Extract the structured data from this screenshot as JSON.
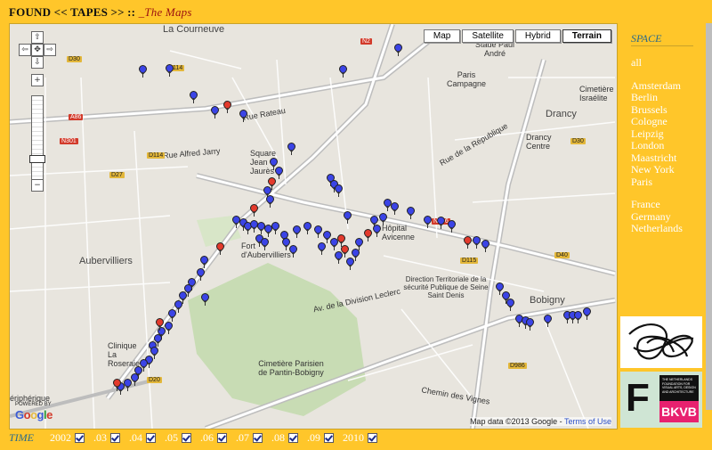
{
  "header": {
    "title": "FOUND << TAPES >> :: ",
    "subtitle": "_The Maps"
  },
  "map": {
    "types": [
      "Map",
      "Satellite",
      "Hybrid",
      "Terrain"
    ],
    "active_type": "Terrain",
    "labels": {
      "la_courneuve": "La Courneuve",
      "stade": "Stade Paul André",
      "paris_campagne": "Paris Campagne",
      "cimetiere_israelite": "Cimetière Israélite",
      "drancy": "Drancy",
      "drancy_centre": "Drancy Centre",
      "aubervilliers": "Aubervilliers",
      "fort": "Fort d'Aubervilliers",
      "cimetiere_parisien": "Cimetière Parisien de Pantin-Bobigny",
      "bobigny": "Bobigny",
      "hopital": "Hôpital Avicenne",
      "direction": "Direction Territoriale de la sécurité Publique de Seine Saint Denis",
      "rue_rateau": "Rue Rateau",
      "rue_alfred_jarry": "Rue Alfred Jarry",
      "rue_de_la_republique": "Rue de la République",
      "av_division_leclerc": "Av. de la Division Leclerc",
      "chemin_vignes": "Chemin des Vignes",
      "peripherique": "ériphérique",
      "clinique": "Clinique La Roseraie",
      "square": "Square Jean Jaurès"
    },
    "road_signs": [
      "D30",
      "D114",
      "N2",
      "A86",
      "N301",
      "D27",
      "D115",
      "D40",
      "N186",
      "D20",
      "D986",
      "D114",
      "D30"
    ],
    "copyright": "Map data ©2013 Google",
    "terms": "Terms of Use",
    "powered_by": "POWERED BY",
    "google": "Google"
  },
  "space": {
    "heading": "SPACE",
    "all": "all",
    "cities": [
      "Amsterdam",
      "Berlin",
      "Brussels",
      "Cologne",
      "Leipzig",
      "London",
      "Maastricht",
      "New York",
      "Paris"
    ],
    "countries": [
      "France",
      "Germany",
      "Netherlands"
    ]
  },
  "time": {
    "heading": "TIME",
    "years": [
      "2002",
      ".03",
      ".04",
      ".05",
      ".06",
      ".07",
      ".08",
      ".09",
      "2010"
    ]
  },
  "logos": {
    "bkvb_letter": "F",
    "bkvb": "BKVB",
    "bkvb_text": "THE NETHERLANDS FOUNDATION FOR VISUAL ARTS, DESIGN AND ARCHITECTURE"
  },
  "colors": {
    "background": "#ffc62a",
    "pin_blue": "#3b44e6",
    "pin_red": "#e33a2c",
    "title_accent": "#9b1010"
  }
}
